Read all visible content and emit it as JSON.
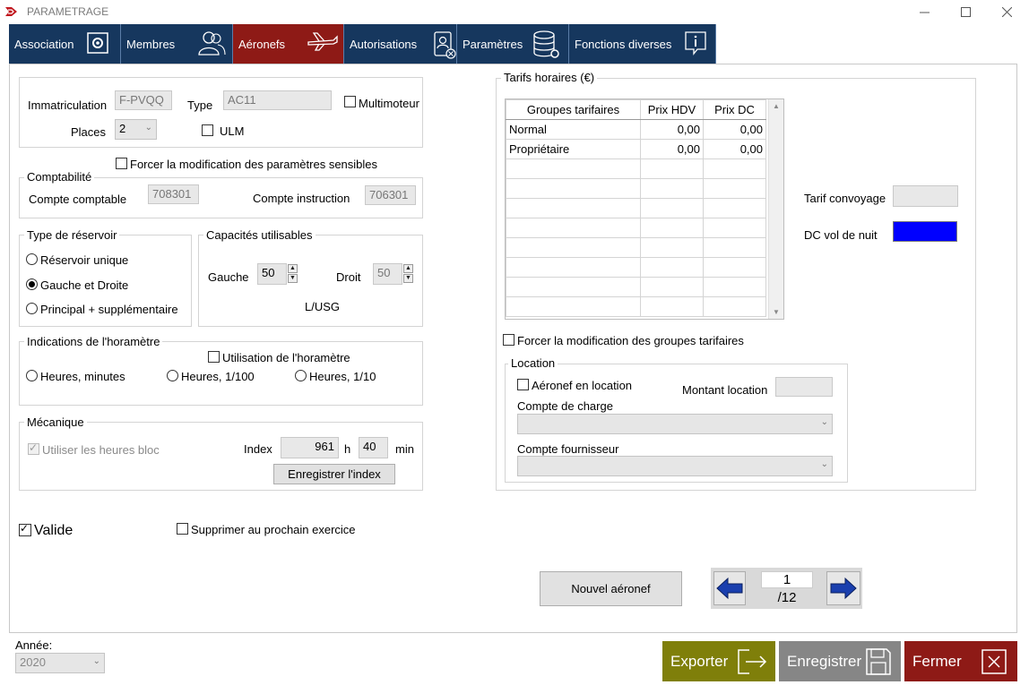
{
  "window": {
    "title": "PARAMETRAGE"
  },
  "tabs": [
    {
      "label": "Association",
      "icon": "gear-icon"
    },
    {
      "label": "Membres",
      "icon": "members-icon"
    },
    {
      "label": "Aéronefs",
      "icon": "airplane-icon"
    },
    {
      "label": "Autorisations",
      "icon": "badge-icon"
    },
    {
      "label": "Paramètres",
      "icon": "database-icon"
    },
    {
      "label": "Fonctions diverses",
      "icon": "info-icon"
    }
  ],
  "aircraft": {
    "immatriculation_label": "Immatriculation",
    "immatriculation_value": "F-PVQQ",
    "type_label": "Type",
    "type_value": "AC11",
    "multimoteur_label": "Multimoteur",
    "places_label": "Places",
    "places_value": "2",
    "ulm_label": "ULM",
    "force_sensitive_label": "Forcer la modification des paramètres sensibles"
  },
  "comptabilite": {
    "title": "Comptabilité",
    "compte_comptable_label": "Compte   comptable",
    "compte_comptable_value": "708301",
    "compte_instruction_label": "Compte  instruction",
    "compte_instruction_value": "706301"
  },
  "reservoir": {
    "title": "Type de réservoir",
    "options": [
      "Réservoir unique",
      "Gauche et Droite",
      "Principal + supplémentaire"
    ],
    "selected": "Gauche et Droite"
  },
  "capacites": {
    "title": "Capacités utilisables",
    "gauche_label": "Gauche",
    "gauche_value": "50",
    "droit_label": "Droit",
    "droit_value": "50",
    "unit": "L/USG"
  },
  "horametre": {
    "title": "Indications de l'horamètre",
    "use_label": "Utilisation de l'horamètre",
    "options": [
      "Heures, minutes",
      "Heures, 1/100",
      "Heures, 1/10"
    ]
  },
  "mecanique": {
    "title": "Mécanique",
    "heures_bloc_label": "Utiliser les heures bloc",
    "index_label": "Index",
    "hours_value": "961",
    "h_label": "h",
    "minutes_value": "40",
    "min_label": "min",
    "save_index_label": "Enregistrer l'index"
  },
  "status": {
    "valide_label": "Valide",
    "supprimer_label": "Supprimer au prochain exercice"
  },
  "tarifs": {
    "title": "Tarifs horaires (€)",
    "headers": [
      "Groupes tarifaires",
      "Prix HDV",
      "Prix DC"
    ],
    "rows": [
      [
        "Normal",
        "0,00",
        "0,00"
      ],
      [
        "Propriétaire",
        "0,00",
        "0,00"
      ]
    ],
    "tarif_convoyage_label": "Tarif convoyage",
    "dc_vol_nuit_label": "DC vol de nuit",
    "dc_vol_nuit_color": "#0000ff",
    "force_groups_label": "Forcer la modification des groupes tarifaires"
  },
  "location": {
    "title": "Location",
    "en_location_label": "Aéronef en location",
    "montant_label": "Montant location",
    "compte_charge_label": "Compte de charge",
    "compte_fournisseur_label": "Compte fournisseur"
  },
  "navigation": {
    "new_label": "Nouvel aéronef",
    "current": "1",
    "total": "/12"
  },
  "annee": {
    "label": "Année:",
    "value": "2020"
  },
  "actions": {
    "export_label": "Exporter",
    "save_label": "Enregistrer",
    "close_label": "Fermer",
    "export_color": "#7f7f0a",
    "save_color": "#868686",
    "close_color": "#8e1a16"
  }
}
